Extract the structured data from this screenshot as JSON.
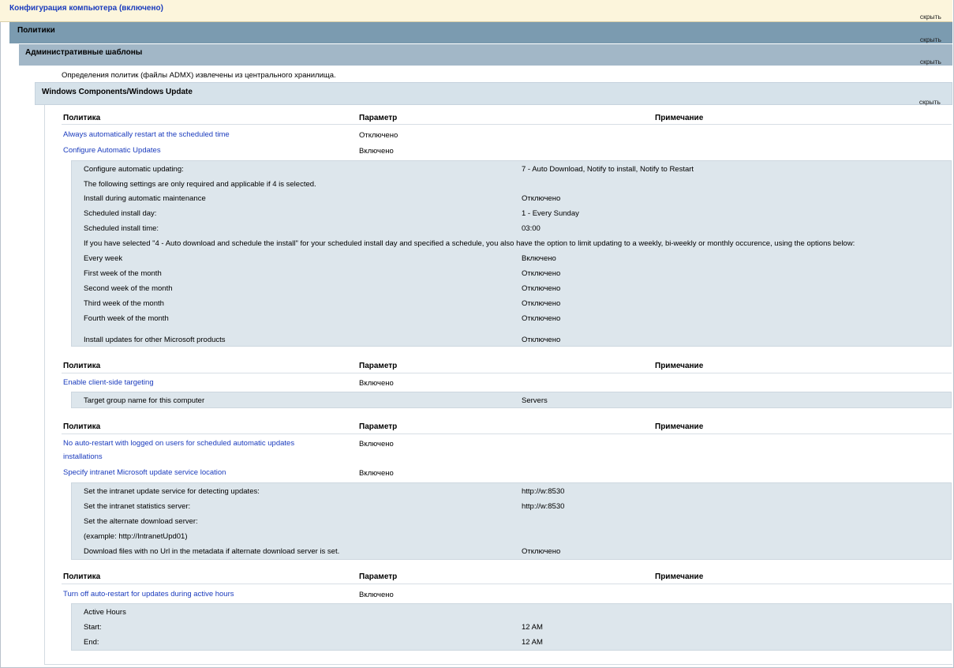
{
  "header": {
    "computer_config": "Конфигурация компьютера (включено)",
    "policies": "Политики",
    "admin_templates": "Административные шаблоны",
    "admx_note": "Определения политик (файлы ADMX) извлечены из центрального хранилища.",
    "category": "Windows Components/Windows Update",
    "hide_label": "скрыть"
  },
  "columns": {
    "policy": "Политика",
    "setting": "Параметр",
    "comment": "Примечание"
  },
  "policies": {
    "p1": {
      "name": "Always automatically restart at the scheduled time",
      "value": "Отключено"
    },
    "p2": {
      "name": "Configure Automatic Updates",
      "value": "Включено",
      "details": [
        {
          "label": "Configure automatic updating:",
          "value": "7 - Auto Download, Notify to install, Notify to Restart"
        },
        {
          "label": "The following settings are only required and applicable if 4 is selected.",
          "value": ""
        },
        {
          "label": "Install during automatic maintenance",
          "value": "Отключено"
        },
        {
          "label": "Scheduled install day:",
          "value": "1 - Every Sunday"
        },
        {
          "label": "Scheduled install time:",
          "value": "03:00"
        },
        {
          "label": "If you have selected \"4 - Auto download and schedule the install\" for your scheduled install day and specified a schedule, you also have the option to limit updating to a weekly, bi-weekly or monthly occurence, using the options below:",
          "value": ""
        },
        {
          "label": "Every week",
          "value": "Включено"
        },
        {
          "label": "First week of the month",
          "value": "Отключено"
        },
        {
          "label": "Second week of the month",
          "value": "Отключено"
        },
        {
          "label": "Third week of the month",
          "value": "Отключено"
        },
        {
          "label": "Fourth week of the month",
          "value": "Отключено"
        },
        {
          "label": "Install updates for other Microsoft products",
          "value": "Отключено"
        }
      ]
    },
    "p3": {
      "name": "Enable client-side targeting",
      "value": "Включено",
      "details": [
        {
          "label": "Target group name for this computer",
          "value": "Servers"
        }
      ]
    },
    "p4": {
      "name_line1": "No auto-restart with logged on users for scheduled automatic updates",
      "name_line2": "installations",
      "value": "Включено"
    },
    "p5": {
      "name": "Specify intranet Microsoft update service location",
      "value": "Включено",
      "details": [
        {
          "label": "Set the intranet update service for detecting updates:",
          "value": "http://w:8530"
        },
        {
          "label": "Set the intranet statistics server:",
          "value": "http://w:8530"
        },
        {
          "label": "Set the alternate download server:",
          "value": ""
        },
        {
          "label": "(example: http://IntranetUpd01)",
          "value": ""
        },
        {
          "label": "Download files with no Url in the metadata if alternate download server is set.",
          "value": "Отключено"
        }
      ]
    },
    "p6": {
      "name": "Turn off auto-restart for updates during active hours",
      "value": "Включено",
      "details": [
        {
          "label": "Active Hours",
          "value": ""
        },
        {
          "label": "Start:",
          "value": "12 AM"
        },
        {
          "label": "End:",
          "value": "12 AM"
        }
      ]
    }
  }
}
